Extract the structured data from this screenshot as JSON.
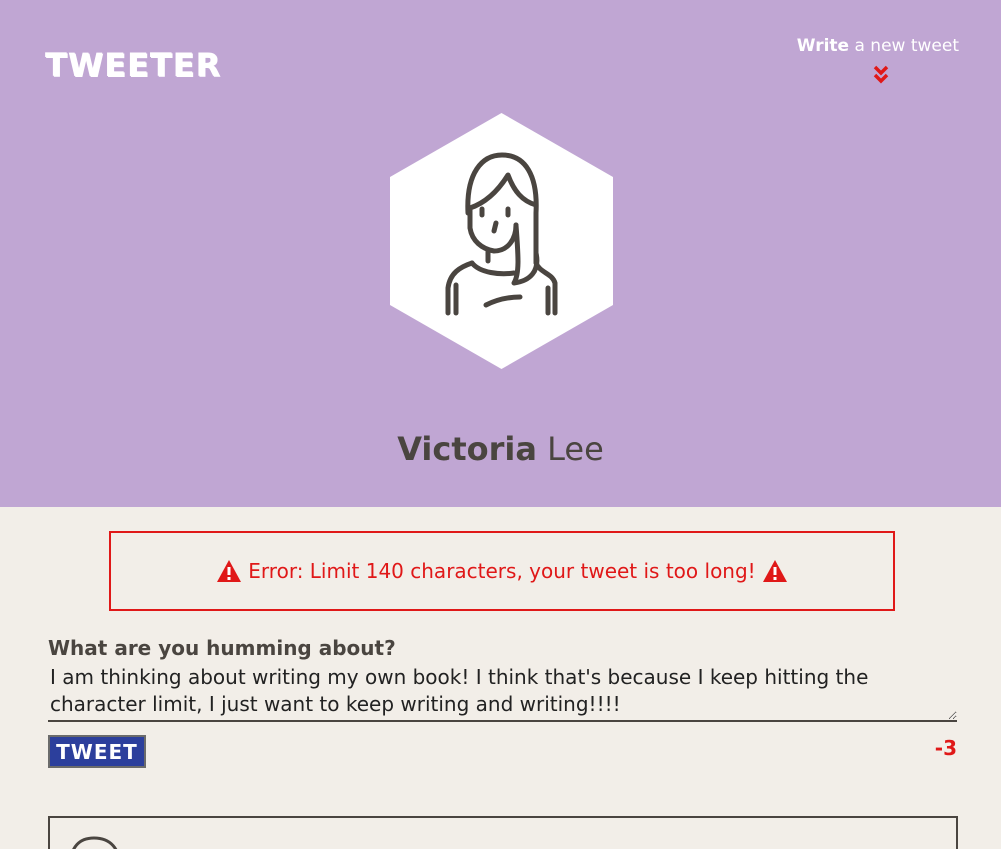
{
  "app": {
    "logo": "TWEETER"
  },
  "nav": {
    "compose_bold": "Write",
    "compose_rest": "a new tweet"
  },
  "profile": {
    "first_name": "Victoria",
    "last_name": "Lee"
  },
  "error": {
    "message": "Error: Limit 140 characters, your tweet is too long!"
  },
  "composer": {
    "label": "What are you humming about?",
    "value": "I am thinking about writing my own book! I think that's because I keep hitting the character limit, I just want to keep writing and writing!!!!",
    "button_label": "TWEET",
    "counter": "-3"
  },
  "colors": {
    "header_bg": "#c0a6d3",
    "page_bg": "#f2eee8",
    "error": "#e01818",
    "button_bg": "#2c3f9c"
  },
  "icons": [
    "chevron-double-down-icon",
    "user-avatar-icon",
    "warning-icon"
  ]
}
